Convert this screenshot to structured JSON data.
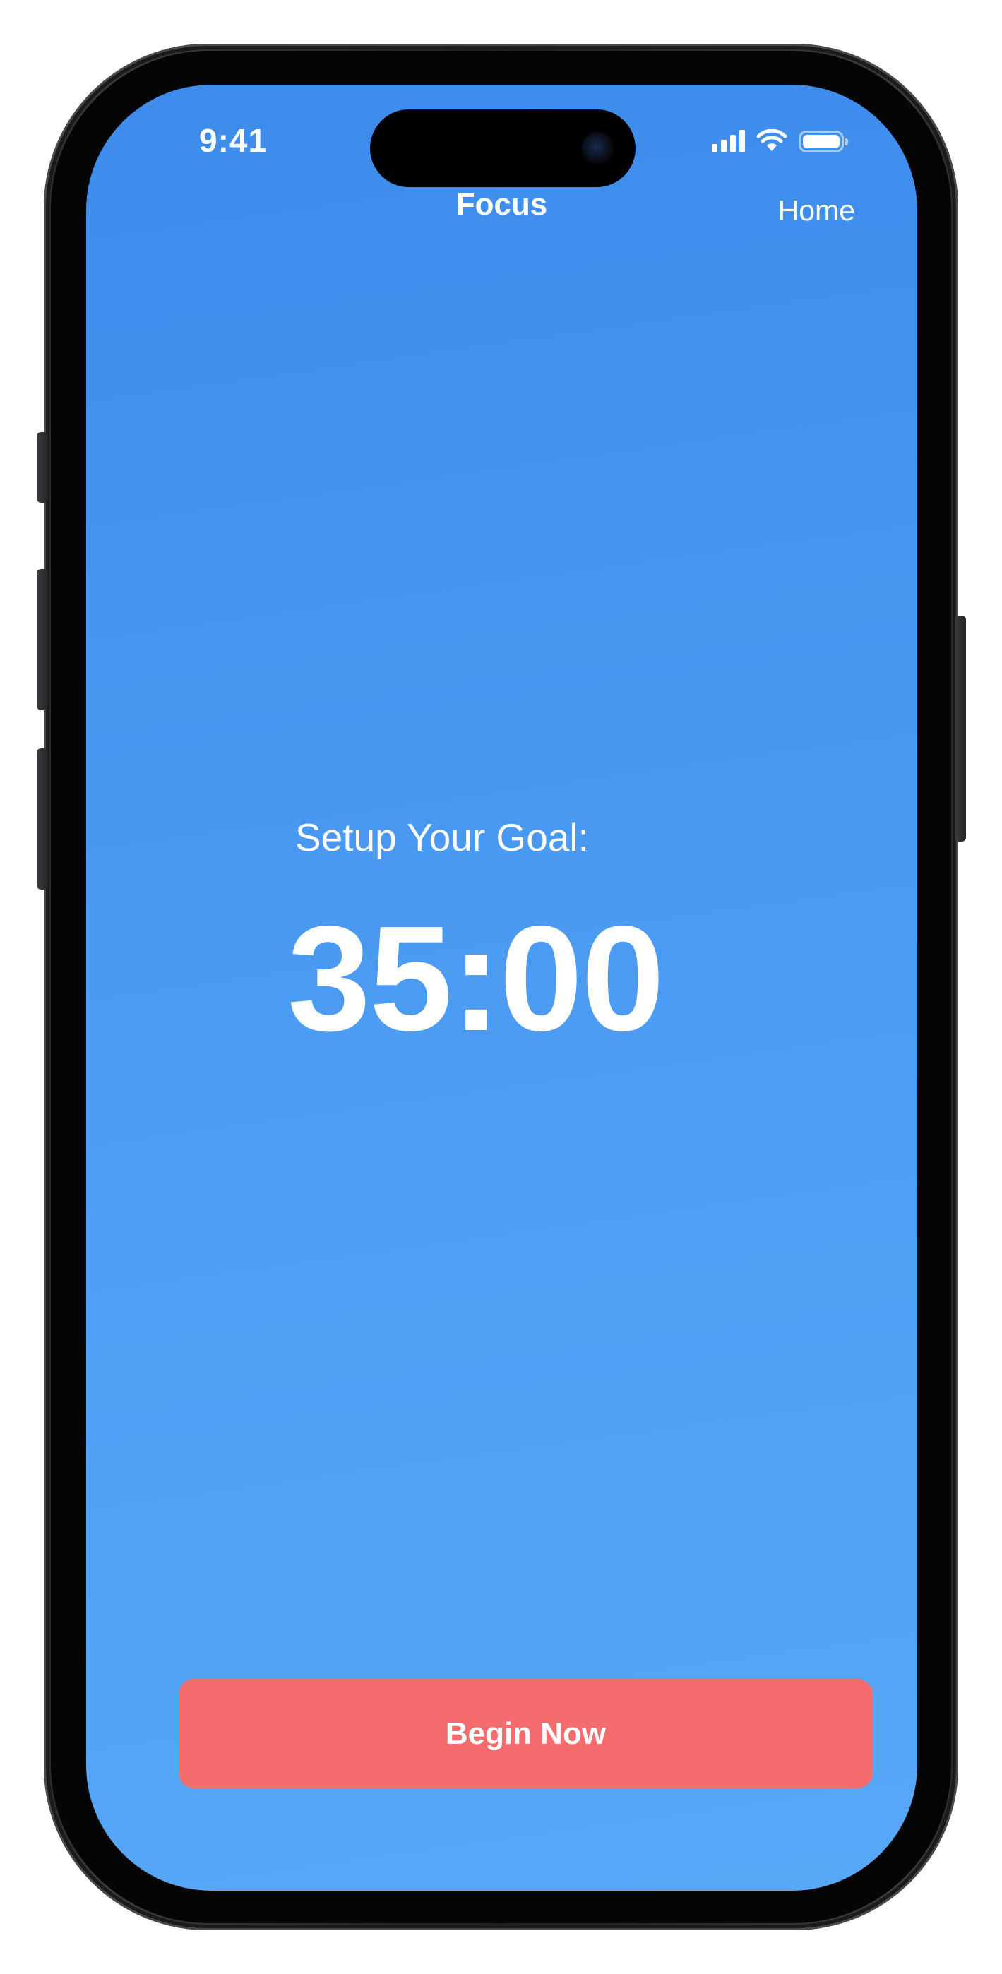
{
  "status_bar": {
    "time": "9:41",
    "icons": [
      "cellular-signal-icon",
      "wifi-icon",
      "battery-icon"
    ]
  },
  "nav": {
    "title": "Focus",
    "home_label": "Home"
  },
  "main": {
    "goal_label": "Setup Your Goal:",
    "timer_value": "35:00"
  },
  "actions": {
    "begin_label": "Begin Now"
  },
  "colors": {
    "background_top": "#3d8bec",
    "background_bottom": "#58a8f8",
    "button": "#f56c6e",
    "text": "#ffffff"
  }
}
